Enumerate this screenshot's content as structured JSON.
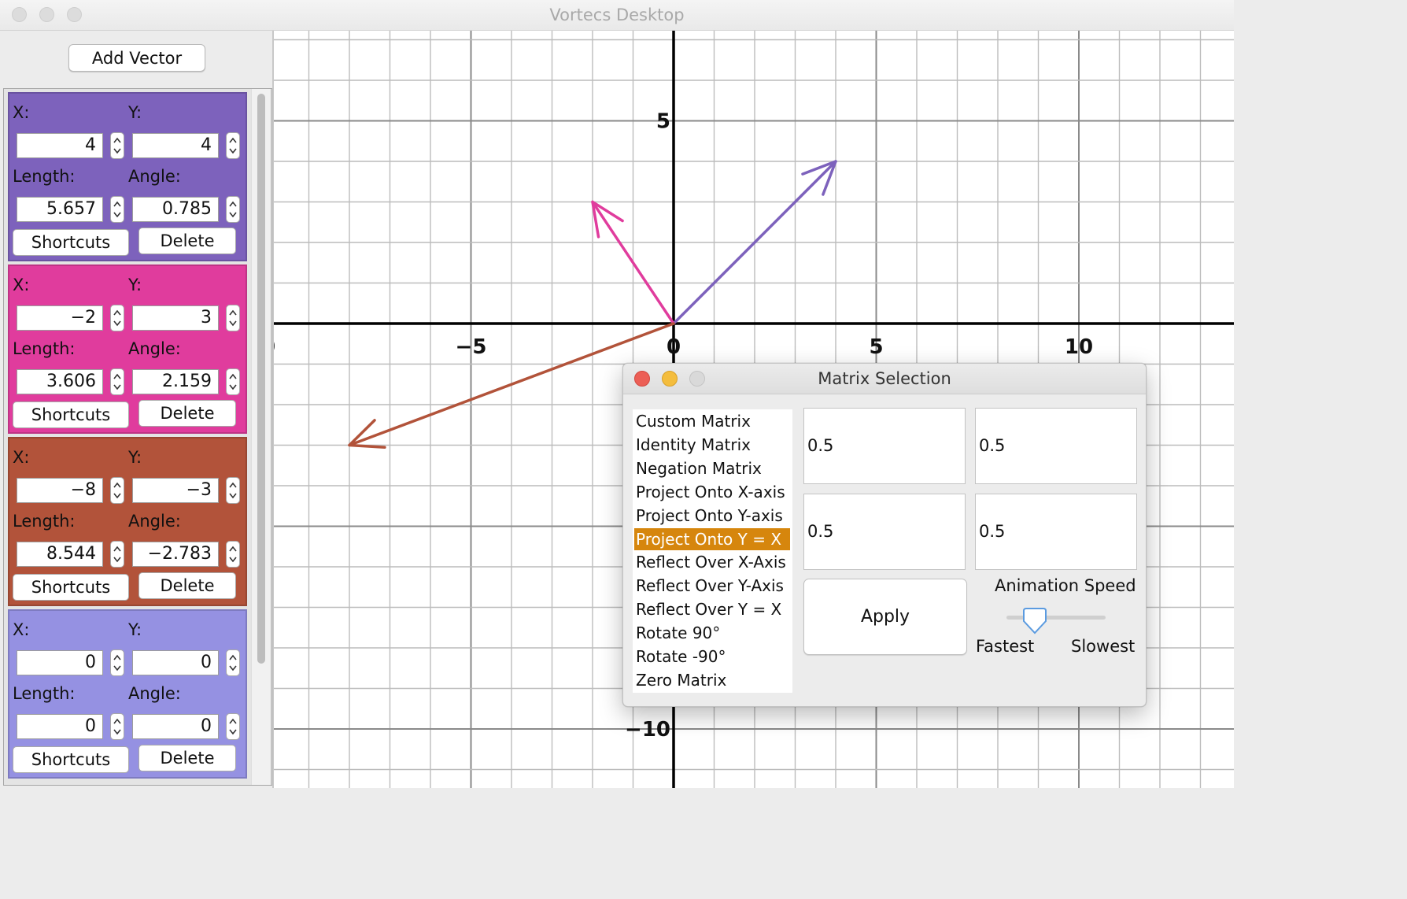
{
  "window": {
    "title": "Vortecs Desktop"
  },
  "sidebar": {
    "add_button": "Add Vector",
    "labels": {
      "x": "X:",
      "y": "Y:",
      "length": "Length:",
      "angle": "Angle:"
    },
    "buttons": {
      "shortcuts": "Shortcuts",
      "delete": "Delete"
    },
    "vectors": [
      {
        "color": "#7d62bc",
        "x": "4",
        "y": "4",
        "length": "5.657",
        "angle": "0.785"
      },
      {
        "color": "#e03c9d",
        "x": "−2",
        "y": "3",
        "length": "3.606",
        "angle": "2.159"
      },
      {
        "color": "#b2533a",
        "x": "−8",
        "y": "−3",
        "length": "8.544",
        "angle": "−2.783"
      },
      {
        "color": "#9591e2",
        "x": "0",
        "y": "0",
        "length": "0",
        "angle": "0"
      }
    ]
  },
  "graph": {
    "x_tick_labels": [
      "0",
      "−5",
      "0",
      "5",
      "10"
    ],
    "y_tick_labels": [
      "5",
      "−10"
    ],
    "arrows": [
      {
        "name": "vector-1-arrow",
        "x": 4,
        "y": 4,
        "color": "#7d62bc"
      },
      {
        "name": "vector-2-arrow",
        "x": -2,
        "y": 3,
        "color": "#e03c9d"
      },
      {
        "name": "vector-3-arrow",
        "x": -8,
        "y": -3,
        "color": "#b2533a"
      }
    ]
  },
  "matrix_dialog": {
    "title": "Matrix Selection",
    "options": [
      "Custom Matrix",
      "Identity Matrix",
      "Negation Matrix",
      "Project Onto X-axis",
      "Project Onto Y-axis",
      "Project Onto Y = X",
      "Reflect Over X-Axis",
      "Reflect Over Y-Axis",
      "Reflect Over Y = X",
      "Rotate 90°",
      "Rotate -90°",
      "Zero Matrix"
    ],
    "selected_option": "Project Onto Y = X",
    "matrix": {
      "a": "0.5",
      "b": "0.5",
      "c": "0.5",
      "d": "0.5"
    },
    "apply_button": "Apply",
    "animation_speed": {
      "label": "Animation Speed",
      "min_label": "Fastest",
      "max_label": "Slowest",
      "value": 0.25
    }
  }
}
